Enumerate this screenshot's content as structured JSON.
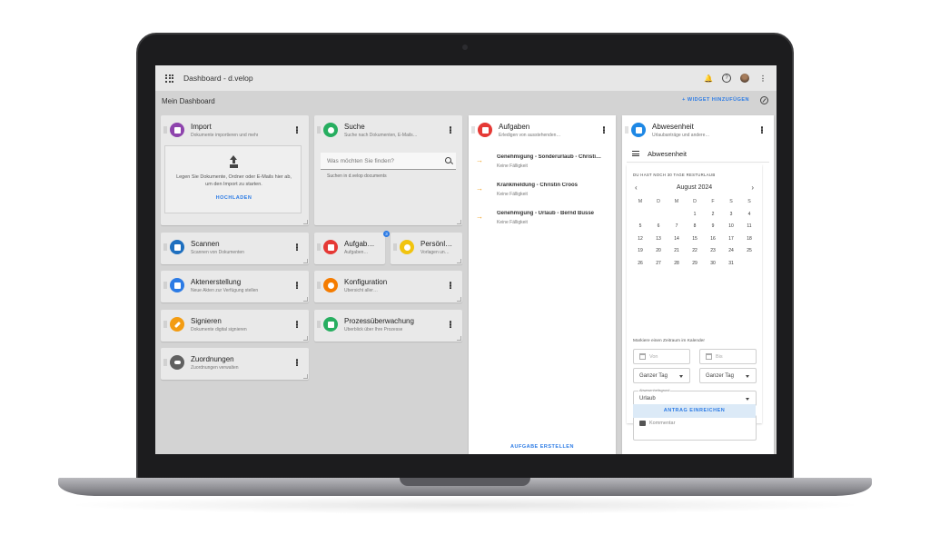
{
  "app": {
    "title": "Dashboard - d.velop"
  },
  "subbar": {
    "title": "Mein Dashboard",
    "add_widget": "+ WIDGET HINZUFÜGEN"
  },
  "colors": {
    "accent": "#2c7be5",
    "import": "#8e44ad",
    "search": "#27ae60",
    "tasks": "#e53935",
    "favorites": "#f1c40f",
    "scan": "#1e6fbf",
    "akte": "#2c7be5",
    "config": "#f57c00",
    "sign": "#f39c12",
    "process": "#27ae60",
    "assign": "#616161",
    "absence": "#1e88e5"
  },
  "tiles": {
    "import": {
      "title": "Import",
      "subtitle": "Dokumente importieren und mehr",
      "drop_text": "Legen Sie Dokumente, Ordner oder E-Mails hier ab, um den Import zu starten.",
      "upload": "HOCHLADEN"
    },
    "search": {
      "title": "Suche",
      "subtitle": "Suche nach Dokumenten, E-Mails…",
      "placeholder": "Was möchten Sie finden?",
      "hint": "Suchen in d.velop documents"
    },
    "scan": {
      "title": "Scannen",
      "subtitle": "Scannen von Dokumenten"
    },
    "akte": {
      "title": "Aktenerstellung",
      "subtitle": "Neue Akten zur Verfügung stellen"
    },
    "sign": {
      "title": "Signieren",
      "subtitle": "Dokumente digital signieren"
    },
    "assign": {
      "title": "Zuordnungen",
      "subtitle": "Zuordnungen verwalten"
    },
    "tasks_small": {
      "title": "Aufgab…",
      "subtitle": "Aufgaben…",
      "badge": "3"
    },
    "personal": {
      "title": "Persönl…",
      "subtitle": "Vorlagen un…"
    },
    "config": {
      "title": "Konfiguration",
      "subtitle": "Übersicht aller…"
    },
    "process": {
      "title": "Prozessüberwachung",
      "subtitle": "Überblick über Ihre Prozesse"
    }
  },
  "tasks_panel": {
    "title": "Aufgaben",
    "subtitle": "Erledigen von ausstehenden…",
    "items": [
      {
        "title": "Genehmigung - Sonderurlaub - Christi…",
        "sub": "Keine Fälligkeit"
      },
      {
        "title": "Krankmeldung - Christin Croos",
        "sub": "Keine Fälligkeit"
      },
      {
        "title": "Genehmigung - Urlaub - Bernd Busse",
        "sub": "Keine Fälligkeit"
      }
    ],
    "create": "AUFGABE ERSTELLEN"
  },
  "absence_panel": {
    "title": "Abwesenheit",
    "subtitle": "Urlaubanträge und andere…",
    "header": "Abwesenheit",
    "rest_info": "DU HAST NOCH 30 TAGE RESTURLAUB",
    "month": "August 2024",
    "weekdays": [
      "M",
      "D",
      "M",
      "D",
      "F",
      "S",
      "S"
    ],
    "days": [
      "",
      "",
      "",
      "1",
      "2",
      "3",
      "4",
      "5",
      "6",
      "7",
      "8",
      "9",
      "10",
      "11",
      "12",
      "13",
      "14",
      "15",
      "16",
      "17",
      "18",
      "19",
      "20",
      "21",
      "22",
      "23",
      "24",
      "25",
      "26",
      "27",
      "28",
      "29",
      "30",
      "31",
      ""
    ],
    "mark_hint": "Markiere einen Zeitraum im Kalender",
    "from_placeholder": "Von",
    "to_placeholder": "Bis",
    "full_day_from": "Ganzer Tag",
    "full_day_to": "Ganzer Tag",
    "reason_label": "Abwesenheitsgrund",
    "reason_value": "Urlaub",
    "comment_placeholder": "Kommentar",
    "submit": "ANTRAG EINREICHEN"
  }
}
